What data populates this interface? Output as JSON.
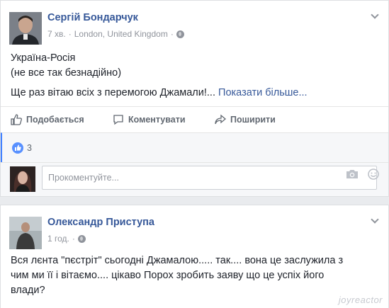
{
  "posts": [
    {
      "author": "Сергій Бондарчук",
      "time": "7 хв.",
      "location": "London, United Kingdom",
      "text_lines": [
        "Україна-Росія",
        "(не все так безнадійно)"
      ],
      "text_extra": "Ще раз вітаю всіх з перемогою Джамали!...",
      "see_more": "Показати більше...",
      "actions": {
        "like": "Подобається",
        "comment": "Коментувати",
        "share": "Поширити"
      },
      "reaction_count": "3",
      "comment_placeholder": "Прокоментуйте..."
    },
    {
      "author": "Олександр Приступа",
      "time": "1 год.",
      "text_lines": [
        "Вся лєнта \"пєстріт\" сьогодні Джамалою..... так.... вона це заслужила з",
        "чим ми її і вітаємо.... цікаво Порох зробить заяву що це успіх його",
        "влади?"
      ]
    }
  ],
  "watermark": "joyreactor",
  "colors": {
    "link": "#365899",
    "like_blue": "#5890ff",
    "meta_gray": "#90949c",
    "action_gray": "#606770"
  },
  "icons": {
    "like": "thumbs-up-icon",
    "comment": "speech-bubble-icon",
    "share": "share-arrow-icon",
    "privacy": "globe-icon",
    "camera": "camera-icon",
    "emoji": "smiley-icon"
  }
}
